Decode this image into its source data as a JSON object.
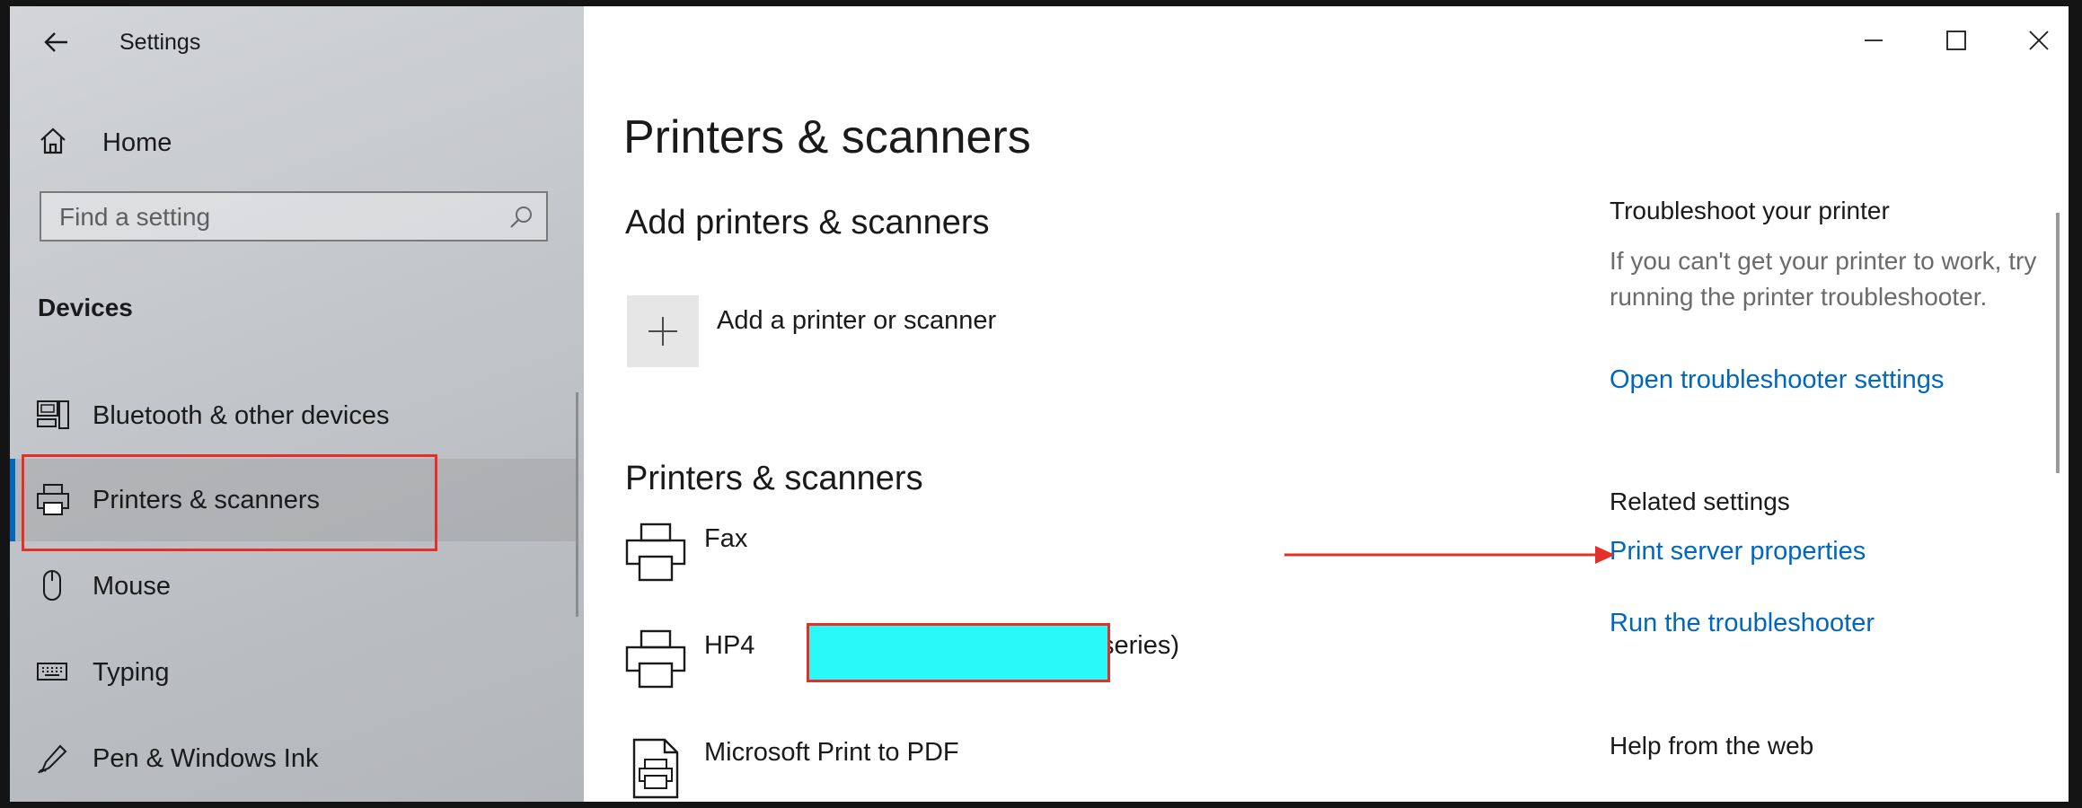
{
  "window": {
    "title": "Settings"
  },
  "sidebar": {
    "home_label": "Home",
    "search_placeholder": "Find a setting",
    "section_title": "Devices",
    "items": [
      {
        "label": "Bluetooth & other devices",
        "icon": "bluetooth-devices-icon"
      },
      {
        "label": "Printers & scanners",
        "icon": "printer-icon",
        "selected": true
      },
      {
        "label": "Mouse",
        "icon": "mouse-icon"
      },
      {
        "label": "Typing",
        "icon": "keyboard-icon"
      },
      {
        "label": "Pen & Windows Ink",
        "icon": "pen-icon"
      }
    ]
  },
  "main": {
    "page_title": "Printers & scanners",
    "add_section_title": "Add printers & scanners",
    "add_label": "Add a printer or scanner",
    "list_title": "Printers & scanners",
    "printers": [
      {
        "name": "Fax",
        "icon": "printer-icon"
      },
      {
        "name_prefix": "HP4",
        "name_suffix": "series)",
        "icon": "printer-icon",
        "redacted": true
      },
      {
        "name": "Microsoft Print to PDF",
        "icon": "pdf-printer-icon"
      }
    ]
  },
  "right": {
    "troubleshoot_title": "Troubleshoot your printer",
    "troubleshoot_text": "If you can't get your printer to work, try running the printer troubleshooter.",
    "open_troubleshooter": "Open troubleshooter settings",
    "related_title": "Related settings",
    "print_server_properties": "Print server properties",
    "run_troubleshooter": "Run the troubleshooter",
    "help_title": "Help from the web"
  },
  "colors": {
    "accent": "#0067c0",
    "annotation": "#e5302a",
    "redaction": "#29f9f8"
  }
}
